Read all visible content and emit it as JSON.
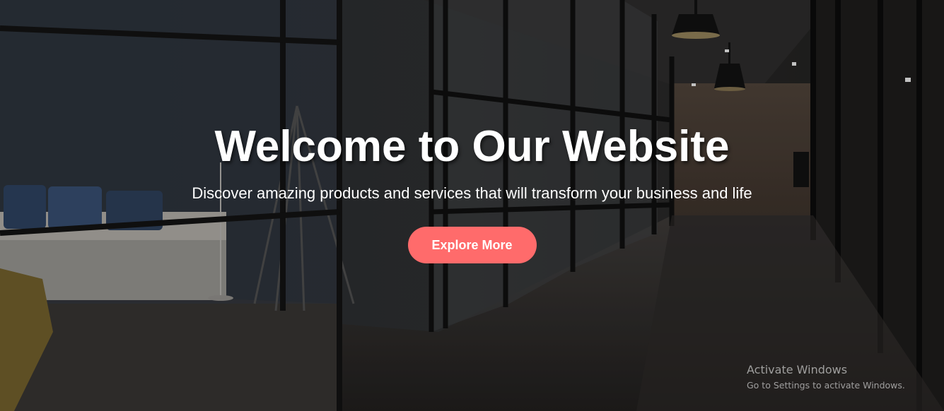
{
  "hero": {
    "title": "Welcome to Our Website",
    "subtitle": "Discover amazing products and services that will transform your business and life",
    "button_label": "Explore More",
    "background_image": "office-corridor-photo"
  },
  "watermark": {
    "title": "Activate Windows",
    "subtitle": "Go to Settings to activate Windows."
  },
  "colors": {
    "button": "#ff6b6b",
    "text": "#ffffff"
  }
}
